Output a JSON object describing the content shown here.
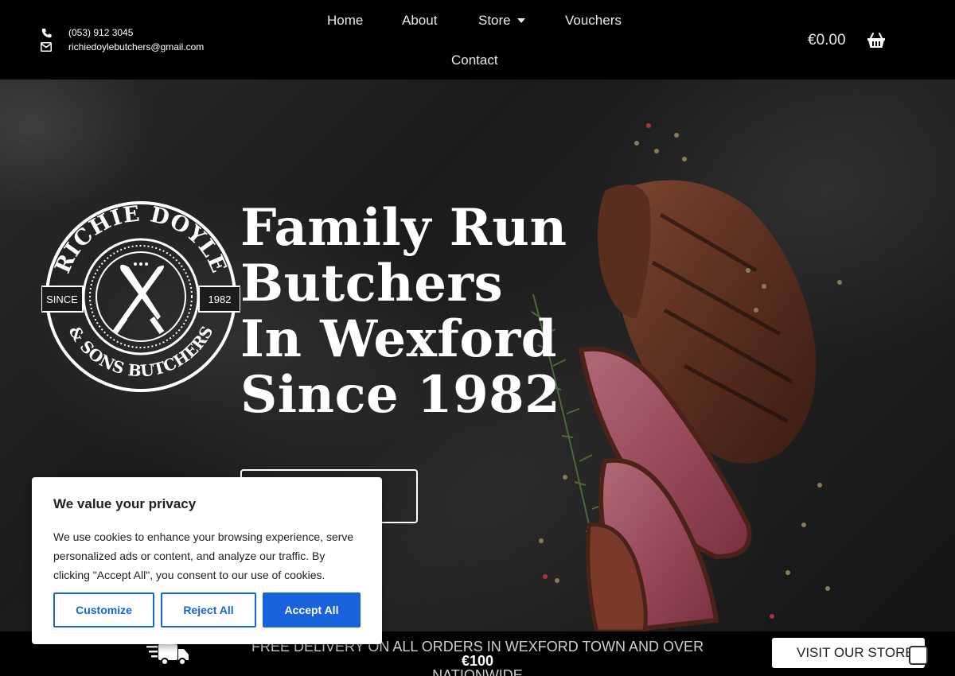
{
  "header": {
    "phone": "(053) 912 3045",
    "email": "richiedoylebutchers@gmail.com",
    "nav": {
      "home": "Home",
      "about": "About",
      "store": "Store",
      "vouchers": "Vouchers",
      "contact": "Contact"
    },
    "cart_total": "€0.00"
  },
  "hero": {
    "logo": {
      "top_text": "RICHIE DOYLE",
      "bottom_text": "& SONS BUTCHERS",
      "since_label": "SINCE",
      "year": "1982"
    },
    "title_lines": [
      "Family Run",
      "Butchers",
      "In Wexford",
      "Since 1982"
    ],
    "shop_button_label": ""
  },
  "bottom_bar": {
    "delivery_text": "FREE DELIVERY ON ALL ORDERS IN WEXFORD TOWN AND OVER",
    "delivery_amount": "€100",
    "delivery_suffix": "NATIONWIDE",
    "visit_button": "VISIT OUR STORE"
  },
  "cookie_banner": {
    "title": "We value your privacy",
    "body": "We use cookies to enhance your browsing experience, serve personalized ads or content, and analyze our traffic. By clicking \"Accept All\", you consent to our use of cookies.",
    "customize": "Customize",
    "reject": "Reject All",
    "accept": "Accept All"
  },
  "icons": {
    "phone": "phone-icon",
    "email": "envelope-icon",
    "cart": "basket-icon",
    "truck": "delivery-truck-icon",
    "logo": "crossed-knives-icon"
  },
  "colors": {
    "header_bg": "#000000",
    "accent_blue": "#1863dc",
    "text_light": "#eaeaea"
  }
}
